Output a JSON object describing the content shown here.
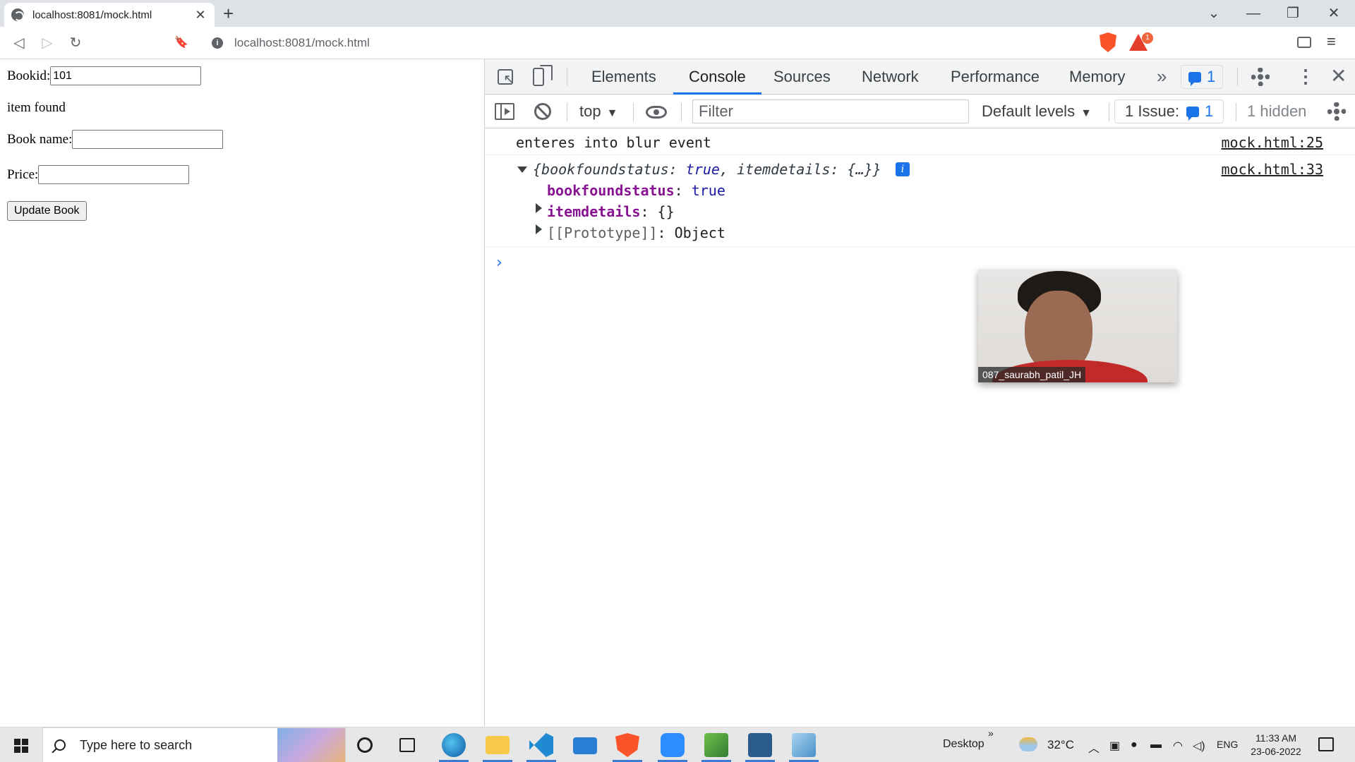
{
  "browser": {
    "tab_title": "localhost:8081/mock.html",
    "tab_close": "✕",
    "new_tab": "+",
    "url": "localhost:8081/mock.html",
    "window_controls": {
      "chevron": "⌄",
      "minimize": "—",
      "restore": "❐",
      "close": "✕"
    },
    "nav": {
      "back": "◁",
      "forward": "▷",
      "reload": "↻",
      "bookmark": "🔖"
    },
    "rewards_badge": "1"
  },
  "page": {
    "bookid_label": "Bookid:",
    "bookid_value": "101",
    "status_text": "item found",
    "bookname_label": "Book name:",
    "bookname_value": "",
    "price_label": "Price:",
    "price_value": "",
    "update_button": "Update Book"
  },
  "devtools": {
    "tabs": [
      "Elements",
      "Console",
      "Sources",
      "Network",
      "Performance",
      "Memory"
    ],
    "active_tab": "Console",
    "more_tabs": "»",
    "issues_badge_count": "1",
    "toolbar": {
      "context": "top",
      "filter_placeholder": "Filter",
      "levels": "Default levels",
      "issue_label": "1 Issue:",
      "issue_count": "1",
      "hidden": "1 hidden"
    },
    "console": {
      "log1_text": "enteres into blur event",
      "log1_source": "mock.html:25",
      "log2_source": "mock.html:33",
      "obj_summary_open": "{bookfoundstatus: ",
      "obj_summary_v1": "true",
      "obj_summary_mid": ", itemdetails: {…}}",
      "prop1_key": "bookfoundstatus",
      "prop1_sep": ": ",
      "prop1_val": "true",
      "prop2_key": "itemdetails",
      "prop2_rest": ": {}",
      "prop3_key": "[[Prototype]]",
      "prop3_rest": ": Object",
      "prompt": "›"
    }
  },
  "webcam": {
    "label": "087_saurabh_patil_JH"
  },
  "taskbar": {
    "search_placeholder": "Type here to search",
    "desktop_label": "Desktop",
    "desktop_chevron": "»",
    "temperature": "32°C",
    "language": "ENG",
    "time": "11:33 AM",
    "date": "23-06-2022"
  },
  "colors": {
    "accent": "#1a73e8",
    "brave": "#fb542b",
    "console_key": "#881391",
    "console_value": "#1a1aa6"
  }
}
